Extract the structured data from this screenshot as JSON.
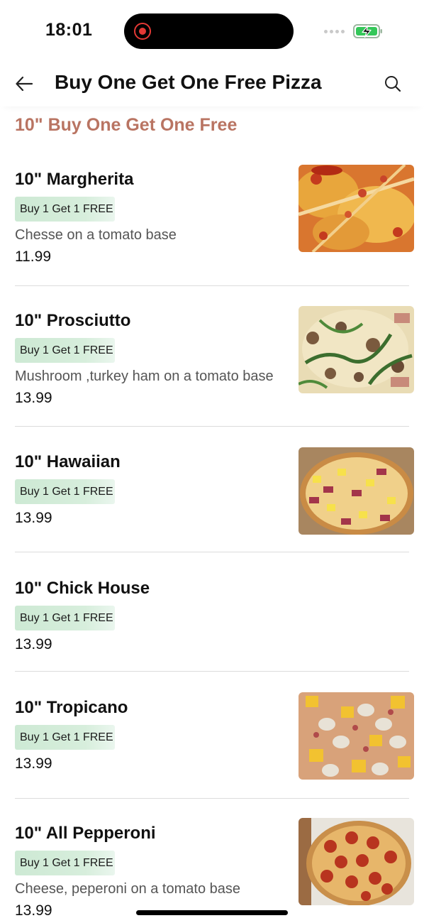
{
  "status_bar": {
    "time": "18:01"
  },
  "header": {
    "back_icon": "arrow-left-icon",
    "title": "Buy One Get One Free Pizza",
    "search_icon": "search-icon"
  },
  "section": {
    "title": "10\" Buy One Get One Free"
  },
  "menu_items": [
    {
      "name": "10\" Margherita",
      "badge": "Buy 1 Get 1 FREE",
      "description": "Chesse on a tomato base",
      "price": "11.99",
      "image": "margherita-pizza-photo"
    },
    {
      "name": "10\" Prosciutto",
      "badge": "Buy 1 Get 1 FREE",
      "description": "Mushroom ,turkey ham on a tomato base",
      "price": "13.99",
      "image": "prosciutto-pizza-photo"
    },
    {
      "name": "10\" Hawaiian",
      "badge": "Buy 1 Get 1 FREE",
      "description": "",
      "price": "13.99",
      "image": "hawaiian-pizza-photo"
    },
    {
      "name": "10\" Chick House",
      "badge": "Buy 1 Get 1 FREE",
      "description": "",
      "price": "13.99",
      "image": ""
    },
    {
      "name": "10\" Tropicano",
      "badge": "Buy 1 Get 1 FREE",
      "description": "",
      "price": "13.99",
      "image": "tropicano-pizza-photo"
    },
    {
      "name": "10\" All Pepperoni",
      "badge": "Buy 1 Get 1 FREE",
      "description": "Cheese, peperoni on a tomato base",
      "price": "13.99",
      "image": "pepperoni-pizza-photo"
    }
  ],
  "colors": {
    "section_title": "#b97462",
    "badge_bg": "#cde9d4",
    "recording": "#e53935",
    "battery_green": "#34c759"
  }
}
